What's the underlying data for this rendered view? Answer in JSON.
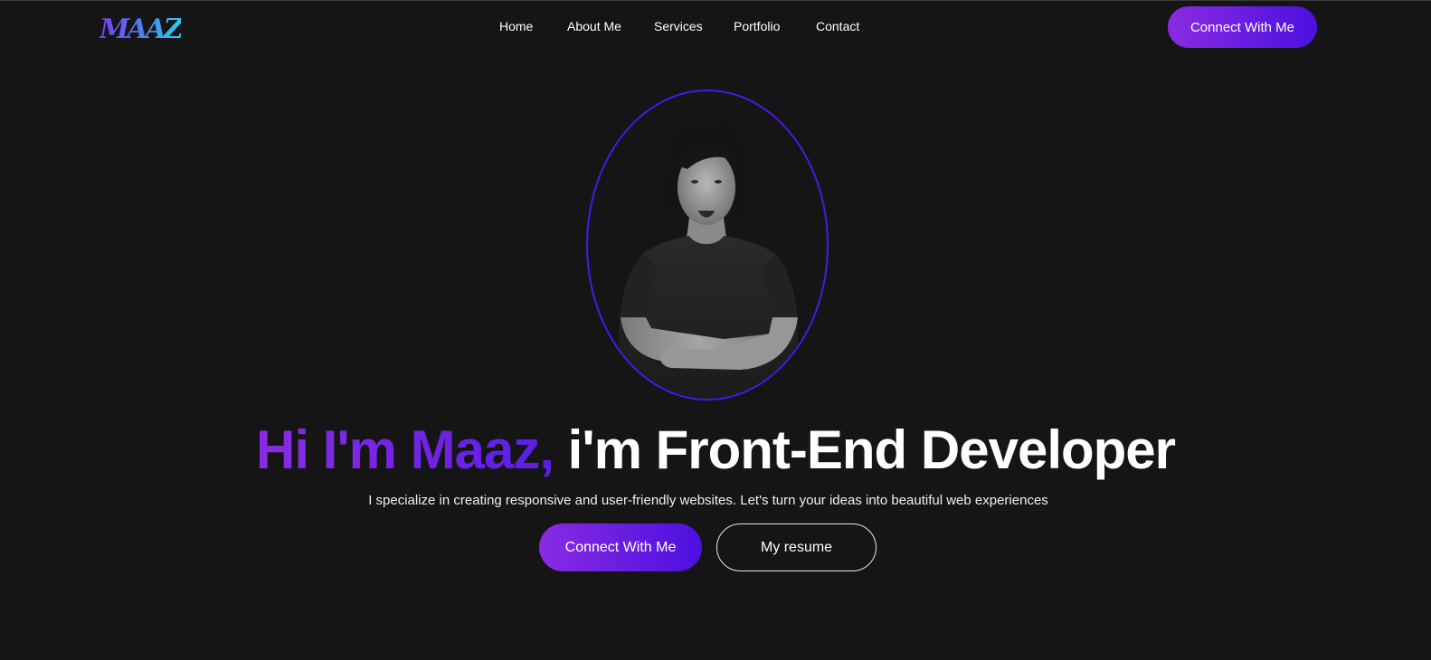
{
  "logo": {
    "text": "MAAZ"
  },
  "nav": {
    "items": [
      "Home",
      "About Me",
      "Services",
      "Portfolio",
      "Contact"
    ]
  },
  "header": {
    "cta_label": "Connect With Me"
  },
  "hero": {
    "avatar_icon": "person-portrait-icon",
    "headline_accent": "Hi I'm Maaz,",
    "headline_rest": " i'm Front-End Developer",
    "subtitle": "I specialize in creating responsive and user-friendly websites. Let's turn your ideas into beautiful web experiences",
    "cta_primary": "Connect With Me",
    "cta_secondary": "My resume"
  },
  "colors": {
    "background": "#161515",
    "accent_start": "#8a2be2",
    "accent_end": "#4b10e0",
    "ring": "#4a17e6"
  }
}
